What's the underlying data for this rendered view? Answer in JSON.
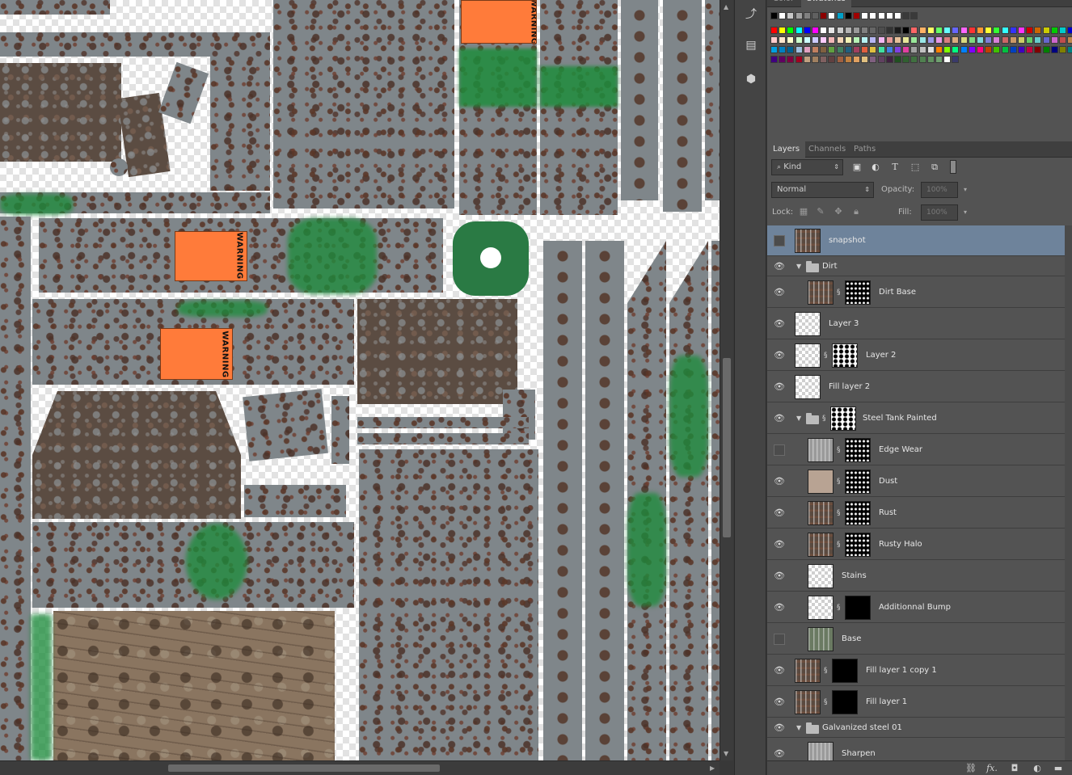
{
  "canvas": {
    "warning_labels": [
      "WARNING",
      "WARNING",
      "WARNING"
    ]
  },
  "dock": {
    "icons": [
      "history-icon",
      "properties-icon",
      "3d-icon"
    ]
  },
  "swatches_panel": {
    "tabs": [
      "Color",
      "Swatches"
    ],
    "active_tab": "Swatches",
    "row0": [
      "#000000",
      "#ffffff",
      "#c8c8c8",
      "#a0a0a0",
      "#808080",
      "#606060",
      "#8b0000",
      "#ffffff",
      "#00a0c8",
      "#000000",
      "#a00000",
      "#ffffff",
      "#ffffff",
      "#ffffff",
      "#ffffff",
      "#ffffff",
      "#3a3a3a",
      "#3a3a3a"
    ],
    "row1": [
      "#ff0000",
      "#ffff00",
      "#00ff00",
      "#00ffff",
      "#0000ff",
      "#ff00ff",
      "#ffffff",
      "#e6e6e6",
      "#cccccc",
      "#b3b3b3",
      "#999999",
      "#808080",
      "#666666",
      "#4d4d4d",
      "#333333",
      "#1a1a1a",
      "#000000",
      "#ff6666",
      "#ffb266",
      "#ffff66",
      "#66ff66",
      "#66ffff",
      "#6666ff",
      "#ff66ff",
      "#ff3333",
      "#ff9933",
      "#ffff33",
      "#33ff33",
      "#33ffff",
      "#3333ff",
      "#ff33ff",
      "#cc0000",
      "#cc6600",
      "#cccc00",
      "#00cc00",
      "#00cccc",
      "#0000cc",
      "#cc00cc"
    ],
    "row2": [
      "#ffcccc",
      "#ffe5cc",
      "#ffffcc",
      "#ccffcc",
      "#ccffff",
      "#ccccff",
      "#ffccff",
      "#f2b6b6",
      "#f2d4b6",
      "#f2f2b6",
      "#b6f2b6",
      "#b6f2f2",
      "#b6b6f2",
      "#f2b6f2",
      "#e69999",
      "#e6bf99",
      "#e6e699",
      "#99e699",
      "#99e6e6",
      "#9999e6",
      "#e699e6",
      "#d97f7f",
      "#d9ac7f",
      "#d9d97f",
      "#7fd97f",
      "#7fd9d9",
      "#7f7fd9",
      "#d97fd9",
      "#cc6666",
      "#cc9966",
      "#cccc66",
      "#66cc66",
      "#66cccc",
      "#6666cc",
      "#cc66cc",
      "#bf4d4d",
      "#bf864d",
      "#bfbf4d"
    ],
    "row3": [
      "#00a0e0",
      "#0080c0",
      "#006090",
      "#a0c0e0",
      "#e0a0c0",
      "#c08060",
      "#806040",
      "#60a040",
      "#408060",
      "#206080",
      "#a04060",
      "#e06040",
      "#e0c040",
      "#40e0a0",
      "#4080e0",
      "#8040e0",
      "#e040a0",
      "#a0a0a0",
      "#c0c0c0",
      "#e0e0e0",
      "#ff8000",
      "#80ff00",
      "#00ff80",
      "#0080ff",
      "#8000ff",
      "#ff0080",
      "#c04000",
      "#40c000",
      "#00c040",
      "#0040c0",
      "#4000c0",
      "#c00040",
      "#800000",
      "#008000",
      "#000080",
      "#808000",
      "#008080",
      "#800080"
    ],
    "row4": [
      "#400080",
      "#600060",
      "#800040",
      "#a00020",
      "#c0a080",
      "#a08060",
      "#806060",
      "#604040",
      "#a06040",
      "#c08040",
      "#e0a060",
      "#e0c080",
      "#806080",
      "#604060",
      "#402040",
      "#205020",
      "#306030",
      "#407040",
      "#508050",
      "#609060",
      "#70a070",
      "#ffffff",
      "#3a3a6a"
    ]
  },
  "layers_panel": {
    "tabs": [
      "Layers",
      "Channels",
      "Paths"
    ],
    "active_tab": "Layers",
    "filter": {
      "label": "Kind"
    },
    "blend_mode": "Normal",
    "opacity": {
      "label": "Opacity:",
      "value": "100%"
    },
    "lock": {
      "label": "Lock:"
    },
    "fill": {
      "label": "Fill:",
      "value": "100%"
    },
    "layers": [
      {
        "name": "snapshot",
        "visible": false,
        "selected": true,
        "indent": 0,
        "type": "layer"
      },
      {
        "name": "Dirt",
        "visible": true,
        "indent": 0,
        "type": "group"
      },
      {
        "name": "Dirt Base",
        "visible": true,
        "indent": 1,
        "type": "layer-mask"
      },
      {
        "name": "Layer 3",
        "visible": true,
        "indent": 0,
        "type": "layer"
      },
      {
        "name": "Layer 2",
        "visible": true,
        "indent": 0,
        "type": "layer-mask"
      },
      {
        "name": "Fill layer 2",
        "visible": true,
        "indent": 0,
        "type": "layer"
      },
      {
        "name": "Steel Tank Painted",
        "visible": true,
        "indent": 0,
        "type": "group-mask"
      },
      {
        "name": "Edge Wear",
        "visible": false,
        "indent": 1,
        "type": "layer-mask"
      },
      {
        "name": "Dust",
        "visible": true,
        "indent": 1,
        "type": "layer-mask"
      },
      {
        "name": "Rust",
        "visible": true,
        "indent": 1,
        "type": "layer-mask"
      },
      {
        "name": "Rusty Halo",
        "visible": true,
        "indent": 1,
        "type": "layer-mask"
      },
      {
        "name": "Stains",
        "visible": true,
        "indent": 1,
        "type": "layer"
      },
      {
        "name": "Additionnal Bump",
        "visible": true,
        "indent": 1,
        "type": "layer-mask"
      },
      {
        "name": "Base",
        "visible": false,
        "indent": 1,
        "type": "layer"
      },
      {
        "name": "Fill layer 1 copy 1",
        "visible": true,
        "indent": 0,
        "type": "layer-mask"
      },
      {
        "name": "Fill layer 1",
        "visible": true,
        "indent": 0,
        "type": "layer-mask"
      },
      {
        "name": "Galvanized steel 01",
        "visible": true,
        "indent": 0,
        "type": "group"
      },
      {
        "name": "Sharpen",
        "visible": true,
        "indent": 1,
        "type": "layer"
      }
    ],
    "bottom_icons": [
      "link-icon",
      "fx-icon",
      "mask-icon",
      "adjustment-icon",
      "new-group-icon"
    ],
    "bottom_labels": {
      "fx": "fx."
    }
  }
}
